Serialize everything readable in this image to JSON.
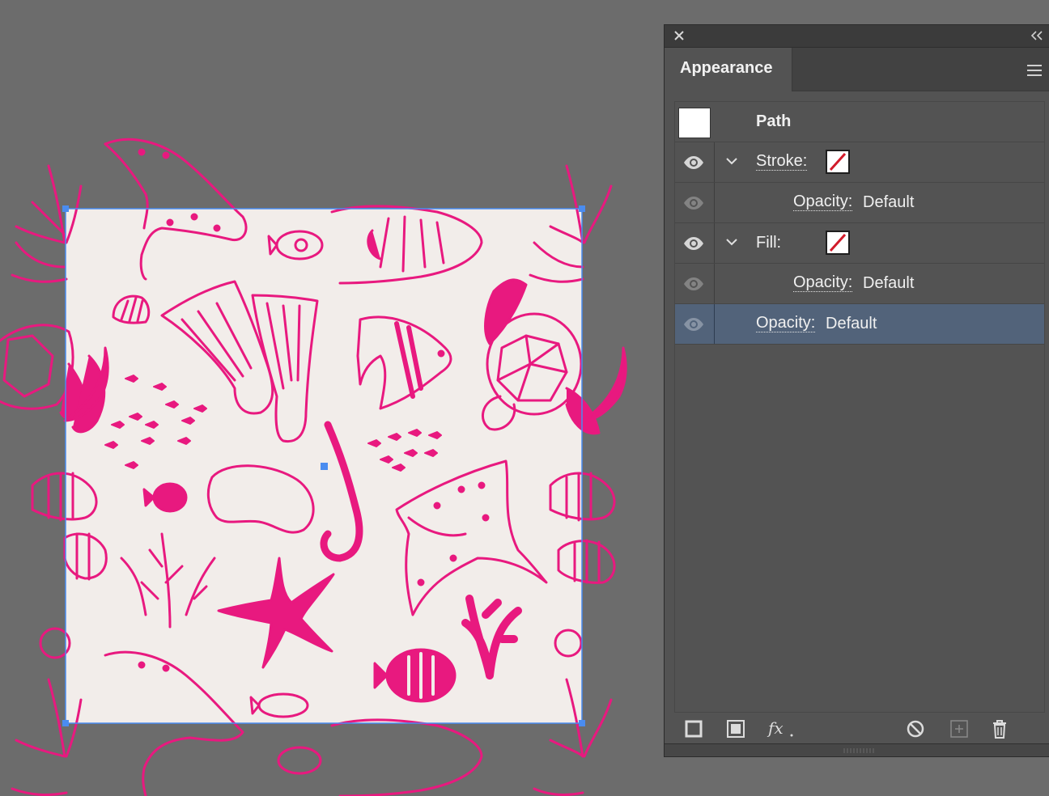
{
  "colors": {
    "canvas_bg": "#6c6c6c",
    "artboard_fill": "#f2edea",
    "art_pink": "#e8197f",
    "selection_blue": "#4a8cf0",
    "panel_bg": "#535353",
    "selected_row": "#52637a",
    "none_slash": "#d11a2a"
  },
  "panel": {
    "tab_label": "Appearance",
    "object_label": "Path",
    "rows": [
      {
        "kind": "stroke",
        "label": "Stroke:",
        "swatch": "none",
        "expanded": true
      },
      {
        "kind": "opacity",
        "label": "Opacity:",
        "value": "Default",
        "indent": true
      },
      {
        "kind": "fill",
        "label": "Fill:",
        "swatch": "none",
        "expanded": true
      },
      {
        "kind": "opacity",
        "label": "Opacity:",
        "value": "Default",
        "indent": true
      },
      {
        "kind": "opacity",
        "label": "Opacity:",
        "value": "Default",
        "selected": true
      }
    ],
    "footer_icons": [
      "add-stroke-icon",
      "add-fill-icon",
      "fx-icon",
      "clear-appearance-icon",
      "duplicate-item-icon",
      "delete-item-icon"
    ]
  }
}
